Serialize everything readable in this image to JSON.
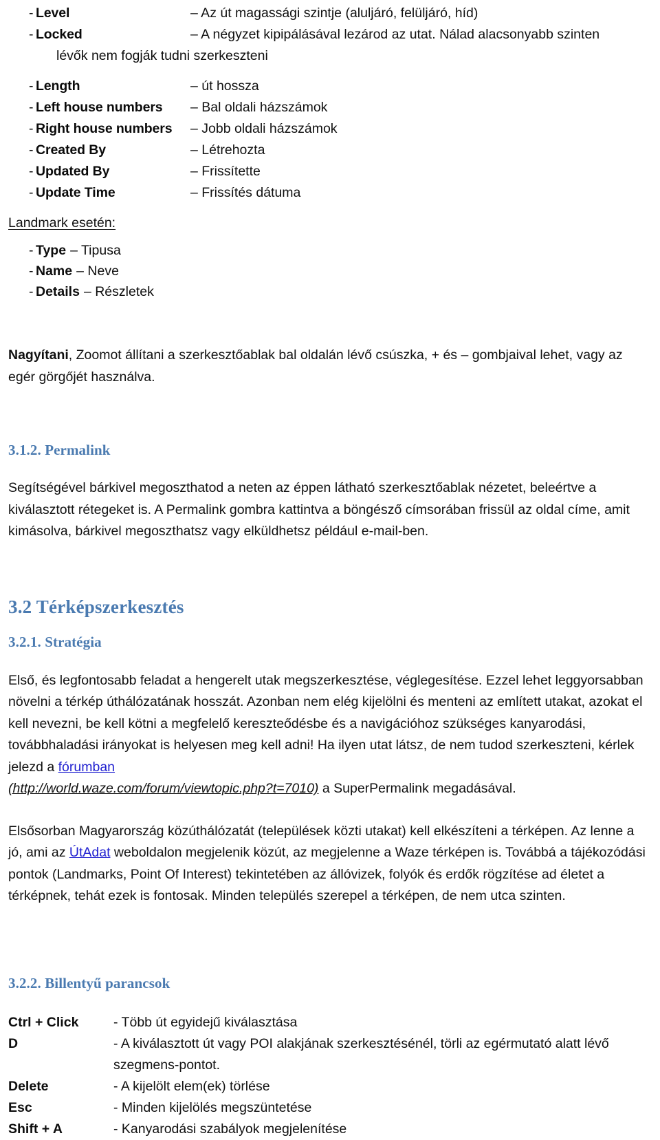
{
  "document": {
    "properties_list": [
      {
        "bullet": "-",
        "term": "Level",
        "desc": "– Az út magassági szintje (aluljáró, felüljáró, híd)"
      },
      {
        "bullet": "-",
        "term": "Locked",
        "desc": "– A négyzet kipipálásával lezárod az utat. Nálad alacsonyabb szinten"
      }
    ],
    "locked_continuation": "lévők nem fogják tudni szerkeszteni",
    "properties_list2": [
      {
        "bullet": "-",
        "term": "Length",
        "desc": "– út hossza"
      },
      {
        "bullet": "-",
        "term": "Left house numbers",
        "desc": "– Bal oldali házszámok"
      },
      {
        "bullet": "-",
        "term": "Right house numbers",
        "desc": "– Jobb oldali házszámok"
      },
      {
        "bullet": "-",
        "term": "Created By",
        "desc": "– Létrehozta"
      },
      {
        "bullet": "-",
        "term": "Updated By",
        "desc": "– Frissítette"
      },
      {
        "bullet": "-",
        "term": "Update Time",
        "desc": "– Frissítés dátuma"
      }
    ],
    "landmark_label": "Landmark esetén:",
    "landmark_list": [
      {
        "bullet": "-",
        "term": "Type",
        "desc": "– Tipusa"
      },
      {
        "bullet": "-",
        "term": "Name",
        "desc": "– Neve"
      },
      {
        "bullet": "-",
        "term": "Details",
        "desc": "– Részletek"
      }
    ],
    "zoom_paragraph": {
      "lead": "Nagyítani",
      "rest": ", Zoomot állítani a szerkesztőablak bal oldalán lévő csúszka, + és – gombjaival lehet, vagy az egér görgőjét használva."
    },
    "section_permalink": {
      "heading": "3.1.2. Permalink",
      "paragraph": "Segítségével bárkivel megoszthatod a neten az éppen látható szerkesztőablak nézetet, beleértve a kiválasztott rétegeket is. A Permalink gombra kattintva a böngésző címsorában frissül az oldal címe, amit kimásolva, bárkivel megoszthatsz vagy elküldhetsz például e-mail-ben."
    },
    "section_map_editing": {
      "heading": "3.2 Térképszerkesztés",
      "subsection_strategy": {
        "heading": "3.2.1. Stratégia",
        "paragraph_part1": "Első, és legfontosabb feladat a hengerelt utak megszerkesztése, véglegesítése. Ezzel lehet leggyorsabban növelni a térkép úthálózatának hosszát. Azonban nem elég kijelölni és menteni az említett utakat, azokat el kell nevezni, be kell kötni a megfelelő kereszteődésbe és a navigációhoz szükséges kanyarodási, továbbhaladási irányokat is helyesen meg kell adni! Ha ilyen utat látsz, de nem tudod szerkeszteni, kérlek jelezd a ",
        "link_text": "fórumban",
        "url_text": "(http://world.waze.com/forum/viewtopic.php?t=7010)",
        "paragraph_part2": " a SuperPermalink megadásával.",
        "paragraph2_part1": "Elsősorban Magyarország közúthálózatát (települések közti utakat) kell elkészíteni a térképen. Az lenne a jó, ami az ",
        "link2_text": "ÚtAdat",
        "paragraph2_part2": " weboldalon megjelenik közút, az megjelenne a Waze térképen is. Továbbá a tájékozódási pontok (Landmarks, Point Of Interest) tekintetében az állóvizek, folyók és erdők rögzítése ad életet a térképnek, tehát ezek is fontosak. Minden település szerepel a térképen, de nem utca szinten."
      },
      "subsection_shortcuts": {
        "heading": "3.2.2. Billentyű parancsok",
        "rows": [
          {
            "key": "Ctrl + Click",
            "desc": "- Több út egyidejű kiválasztása"
          },
          {
            "key": "D",
            "desc": "- A kiválasztott út vagy POI alakjának szerkesztésénél, törli az egérmutató alatt lévő szegmens-pontot."
          },
          {
            "key": "Delete",
            "desc": "- A kijelölt elem(ek) törlése"
          },
          {
            "key": "Esc",
            "desc": "- Minden kijelölés megszüntetése"
          },
          {
            "key": "Shift + A",
            "desc": "- Kanyarodási szabályok megjelenítése"
          }
        ]
      }
    },
    "colors": {
      "heading": "#4a7ab0",
      "link": "#1f1fd0",
      "text": "#111111"
    }
  }
}
